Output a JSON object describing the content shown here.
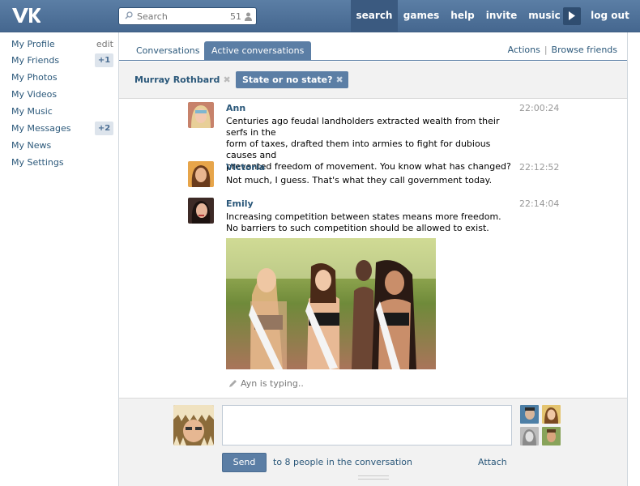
{
  "header": {
    "logo_text": "VK",
    "search": {
      "placeholder": "Search",
      "count": "51"
    },
    "nav": [
      "search",
      "games",
      "help",
      "invite",
      "music"
    ],
    "logout": "log out"
  },
  "sidebar": {
    "items": [
      {
        "label": "My Profile",
        "extra": "edit"
      },
      {
        "label": "My Friends",
        "badge": "+1"
      },
      {
        "label": "My Photos"
      },
      {
        "label": "My Videos"
      },
      {
        "label": "My Music"
      },
      {
        "label": "My Messages",
        "badge": "+2"
      },
      {
        "label": "My News"
      },
      {
        "label": "My Settings"
      }
    ]
  },
  "tabs": {
    "items": [
      "Conversations",
      "Active conversations"
    ],
    "actions": "Actions",
    "browse_friends": "Browse friends"
  },
  "chips": [
    "Murray Rothbard",
    "State or no state?"
  ],
  "messages": [
    {
      "name": "Ann",
      "time": "22:00:24",
      "lines": [
        "Centuries ago feudal landholders extracted wealth from their serfs in the",
        "form of taxes, drafted them into armies to fight for dubious causes and",
        "prevented freedom of movement. You know what has changed?"
      ]
    },
    {
      "name": "Victoria",
      "time": "22:12:52",
      "lines": [
        "Not much, I guess. That's what they call government today."
      ]
    },
    {
      "name": "Emily",
      "time": "22:14:04",
      "lines": [
        "Increasing competition between states means more freedom.",
        "No barriers to such competition should be allowed to exist."
      ]
    }
  ],
  "typing": "Ayn is typing..",
  "composer": {
    "send": "Send",
    "recipients": "to 8 people in the conversation",
    "attach": "Attach"
  },
  "colors": {
    "header": "#4a6f96",
    "link": "#2b587a",
    "accent": "#5b7ea5"
  }
}
